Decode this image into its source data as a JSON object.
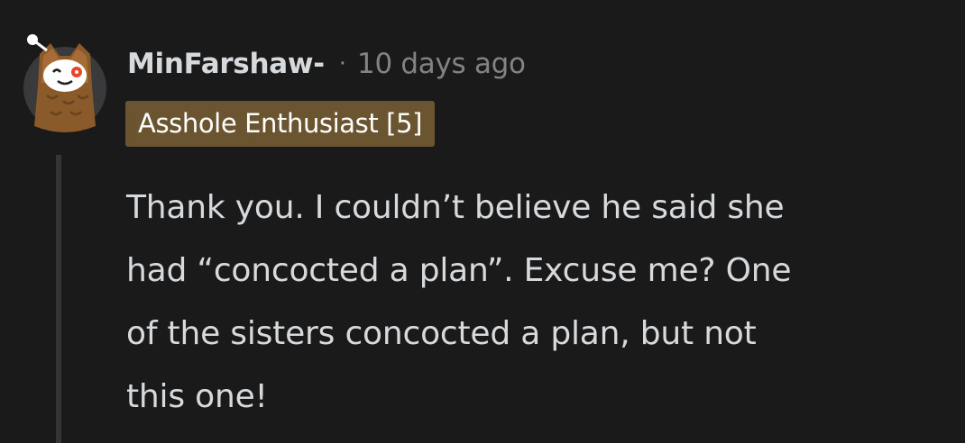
{
  "comment": {
    "author": "MinFarshaw-",
    "separator": "·",
    "time_ago": "10 days ago",
    "flair": {
      "text": "Asshole Enthusiast [5]",
      "background": "#6a5530",
      "color": "#ffffff"
    },
    "body_lines": [
      "Thank you. I couldn’t believe he said she",
      "had “concocted a plan”. Excuse me? One",
      "of the sisters concocted a plan, but not",
      "this one!"
    ],
    "avatar_icon": "owl-snoo-avatar-icon"
  },
  "colors": {
    "background": "#1a1a1b",
    "text": "#d7dadc",
    "muted": "#818384",
    "thread_line": "#343536"
  }
}
